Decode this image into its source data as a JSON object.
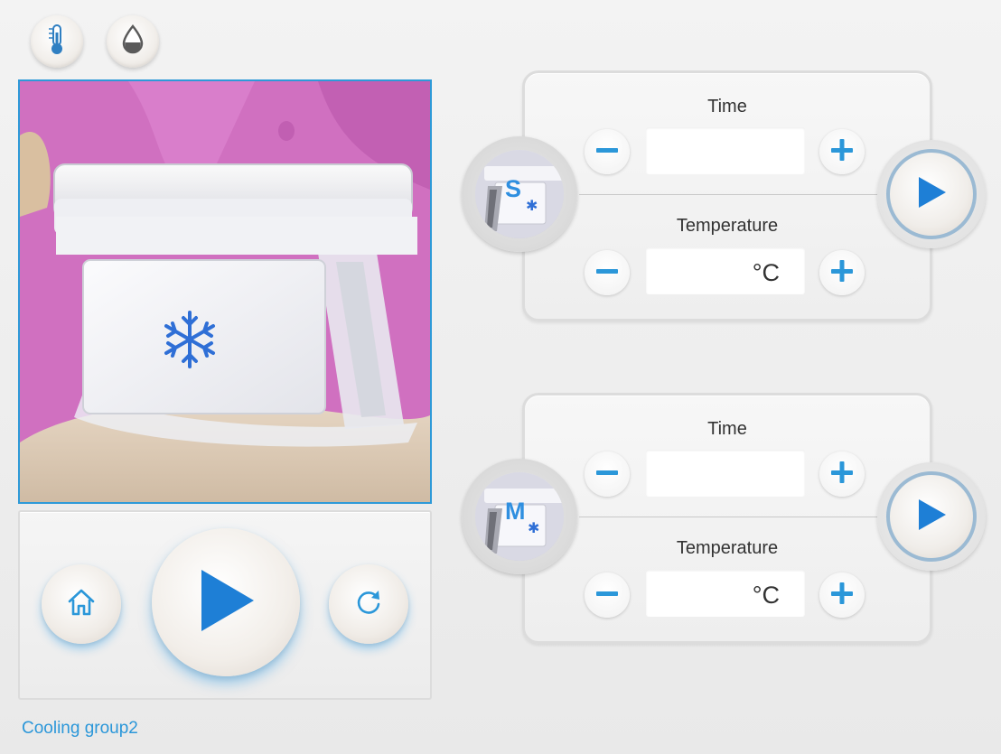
{
  "top_icons": [
    {
      "name": "thermometer-icon"
    },
    {
      "name": "water-drop-icon"
    }
  ],
  "photo": {
    "name": "cooling-applicator-photo"
  },
  "controls": {
    "home": "home-icon",
    "play": "play-icon",
    "reset": "refresh-icon"
  },
  "group_label": "Cooling group2",
  "cards": [
    {
      "handpiece_letter": "S",
      "time_label": "Time",
      "time_value": "",
      "temperature_label": "Temperature",
      "temperature_value": "°C"
    },
    {
      "handpiece_letter": "M",
      "time_label": "Time",
      "time_value": "",
      "temperature_label": "Temperature",
      "temperature_value": "°C"
    }
  ],
  "colors": {
    "accent": "#2b97d9",
    "play": "#1e7fd6",
    "panel_border": "#dcdcdc"
  }
}
